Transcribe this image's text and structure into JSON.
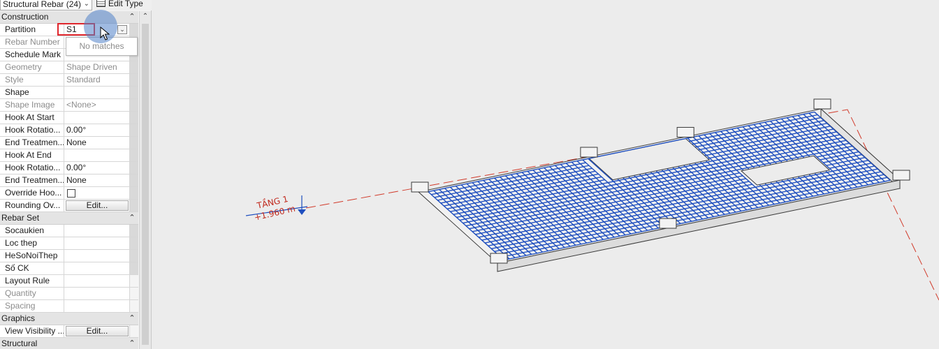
{
  "properties_panel": {
    "type_selector": {
      "value": "Structural Rebar (24)"
    },
    "edit_type_label": "Edit Type",
    "groups": {
      "construction": {
        "label": "Construction"
      },
      "rebar_set": {
        "label": "Rebar Set"
      },
      "graphics": {
        "label": "Graphics"
      },
      "structural": {
        "label": "Structural"
      }
    },
    "rows": {
      "partition": {
        "name": "Partition",
        "value": "S1"
      },
      "rebar_number": {
        "name": "Rebar Number",
        "value": ""
      },
      "schedule_mark": {
        "name": "Schedule Mark",
        "value": ""
      },
      "geometry": {
        "name": "Geometry",
        "value": "Shape Driven"
      },
      "style": {
        "name": "Style",
        "value": "Standard"
      },
      "shape": {
        "name": "Shape",
        "value": ""
      },
      "shape_image": {
        "name": "Shape Image",
        "value": "<None>"
      },
      "hook_at_start": {
        "name": "Hook At Start",
        "value": ""
      },
      "hook_rotation_start": {
        "name": "Hook Rotatio...",
        "value": "0.00°"
      },
      "end_treatment_start": {
        "name": "End Treatmen...",
        "value": "None"
      },
      "hook_at_end": {
        "name": "Hook At End",
        "value": ""
      },
      "hook_rotation_end": {
        "name": "Hook Rotatio...",
        "value": "0.00°"
      },
      "end_treatment_end": {
        "name": "End Treatmen...",
        "value": "None"
      },
      "override_hook": {
        "name": "Override Hoo...",
        "checked": false
      },
      "rounding_overrides": {
        "name": "Rounding Ov...",
        "button": "Edit..."
      },
      "socaukien": {
        "name": "Socaukien",
        "value": ""
      },
      "loc_thep": {
        "name": "Loc thep",
        "value": ""
      },
      "hesonoithep": {
        "name": "HeSoNoiThep",
        "value": ""
      },
      "so_ck": {
        "name": "Số CK",
        "value": ""
      },
      "layout_rule": {
        "name": "Layout Rule",
        "value": ""
      },
      "quantity": {
        "name": "Quantity",
        "value": ""
      },
      "spacing": {
        "name": "Spacing",
        "value": ""
      },
      "view_visibility": {
        "name": "View Visibility ...",
        "button": "Edit..."
      }
    },
    "autocomplete": {
      "message": "No matches"
    }
  },
  "viewport": {
    "level_name": "TẦNG 1",
    "level_elevation": "+1.960 m"
  },
  "colors": {
    "rebar": "#1f4fbf",
    "level": "#d13a2a",
    "concrete_edge": "#3a3a3a",
    "highlight": "#e0262c"
  }
}
